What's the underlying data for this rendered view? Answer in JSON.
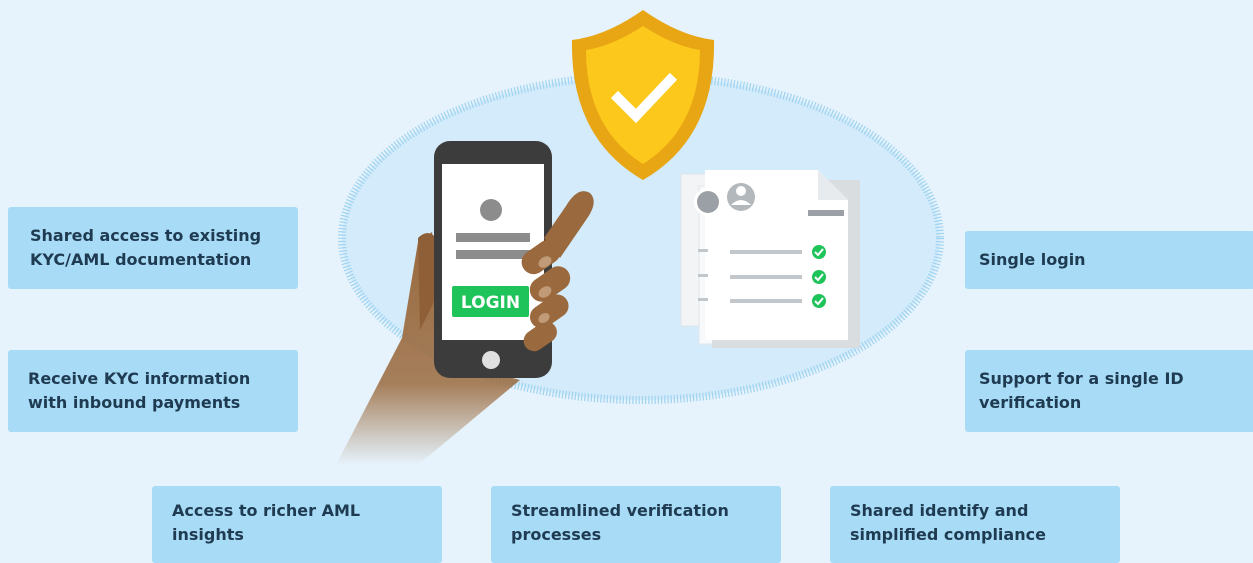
{
  "colors": {
    "background": "#e6f3fc",
    "box": "#a7dbf6",
    "box_text": "#1f3b52",
    "shield": "#fcc81c",
    "login_button": "#1ec35a",
    "check": "#1ec35a",
    "phone": "#3c3c3c",
    "hand": "#9a6a3e"
  },
  "icons": {
    "shield": "shield-check-icon",
    "phone": "smartphone-icon",
    "documents": "document-stack-icon",
    "user": "user-avatar-icon",
    "check": "check-circle-icon"
  },
  "phone": {
    "button_label": "LOGIN"
  },
  "benefits": {
    "shared_access": " Shared access to existing\nKYC/AML documentation",
    "receive_kyc": "Receive KYC information\nwith inbound payments",
    "richer_aml": "Access to richer AML\ninsights",
    "streamlined": "Streamlined verification\nprocesses",
    "shared_identify": "Shared identify and\nsimplified compliance",
    "single_login": "Single login",
    "single_id": "Support for a single ID\nverification"
  }
}
